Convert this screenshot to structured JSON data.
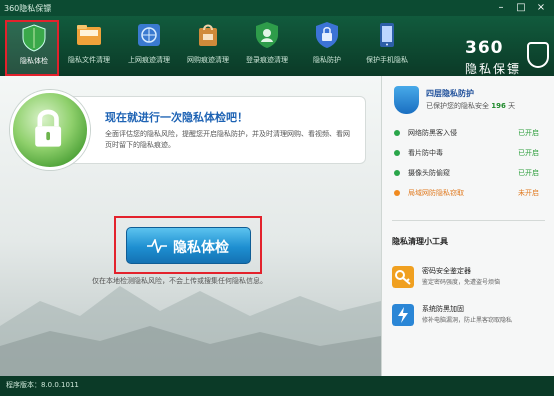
{
  "window": {
    "title": "360隐私保镖",
    "min": "–",
    "max": "□",
    "close": "×"
  },
  "toolbar": {
    "items": [
      {
        "label": "隐私体检",
        "icon": "green-shield-icon",
        "color": "#3aa84a"
      },
      {
        "label": "隐私文件清理",
        "icon": "folder-icon",
        "color": "#f0a23a"
      },
      {
        "label": "上网痕迹清理",
        "icon": "browser-globe-icon",
        "color": "#3a7ad0"
      },
      {
        "label": "网购痕迹清理",
        "icon": "shopping-bag-icon",
        "color": "#d08a3a"
      },
      {
        "label": "登录痕迹清理",
        "icon": "shield-user-icon",
        "color": "#2e9c4a"
      },
      {
        "label": "隐私防护",
        "icon": "lock-shield-icon",
        "color": "#3c73d6"
      },
      {
        "label": "保护手机隐私",
        "icon": "phone-icon",
        "color": "#2d5fa8"
      }
    ]
  },
  "brand": {
    "number": "360",
    "name": "隐私保镖"
  },
  "banner": {
    "title": "现在就进行一次隐私体检吧！",
    "desc": "全面评估您的隐私风险，提醒您开启隐私防护，并及时清理网购、看视频、看网页时留下的隐私痕迹。"
  },
  "scan": {
    "button_label": "隐私体检",
    "note": "仅在本地检测隐私风险，不会上传或搜集任何隐私信息。"
  },
  "side": {
    "title": "四层隐私防护",
    "sub_prefix": "已保护您的隐私安全",
    "days": "196",
    "days_unit": "天",
    "protections": [
      {
        "name": "网络防黑客入侵",
        "status": "已开启",
        "status_color": "#2a9d3a",
        "dot_color": "#2aa64a"
      },
      {
        "name": "看片防中毒",
        "status": "已开启",
        "status_color": "#2a9d3a",
        "dot_color": "#2aa64a"
      },
      {
        "name": "摄像头防偷窥",
        "status": "已开启",
        "status_color": "#2a9d3a",
        "dot_color": "#2aa64a"
      },
      {
        "name": "局域网防隐私窃取",
        "status": "未开启",
        "status_color": "#e07a1f",
        "dot_color": "#f08a1f"
      }
    ],
    "tools_title": "隐私清理小工具",
    "tools": [
      {
        "name": "密码安全鉴定器",
        "desc": "鉴定密码强度，免遭盗号烦恼",
        "icon": "key-icon",
        "color": "#f0a020"
      },
      {
        "name": "系统防黑加固",
        "desc": "修补电脑漏洞，防止黑客窃取隐私",
        "icon": "lightning-shield-icon",
        "color": "#2a86d6"
      }
    ]
  },
  "statusbar": {
    "version": "程序版本：8.0.0.1011"
  }
}
